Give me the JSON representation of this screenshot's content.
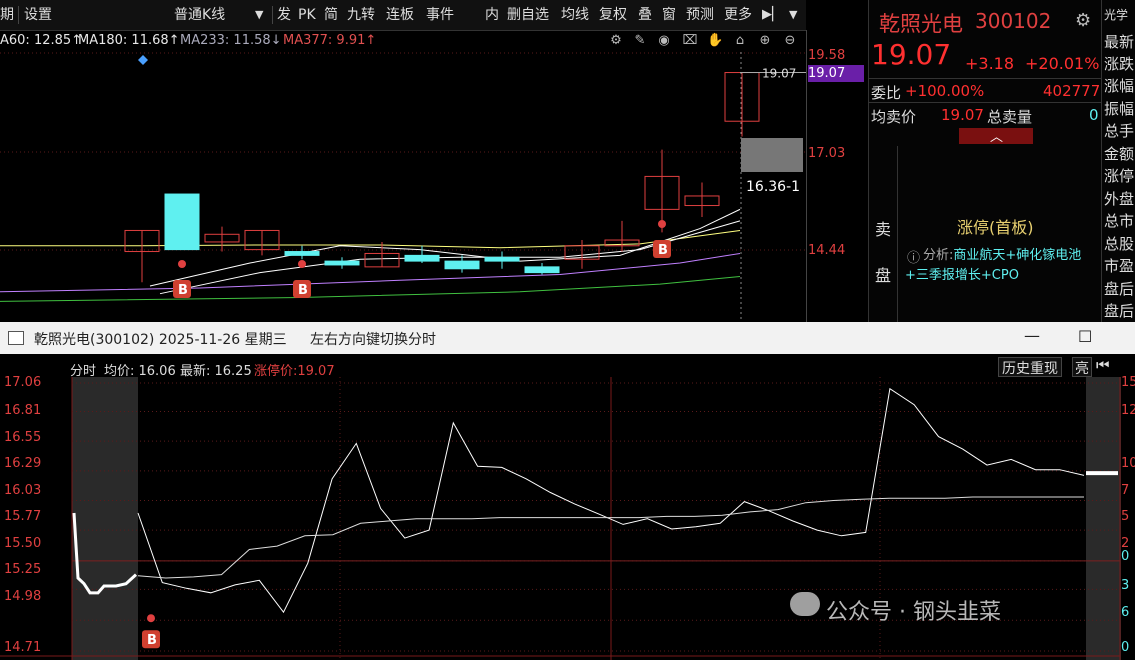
{
  "toolbar": {
    "items": [
      "期",
      "设置",
      "普通K线",
      "发",
      "PK",
      "简",
      "九转",
      "连板",
      "事件",
      "内",
      "删自选",
      "均线",
      "复权",
      "叠",
      "窗",
      "预测",
      "更多"
    ],
    "dropdown_arrow": "▼",
    "end_icon": "▶▏",
    "end_arrow": "▼"
  },
  "ma": {
    "ma60": "A60: 12.85↑",
    "ma180": "MA180: 11.68↑",
    "ma233": "MA233: 11.58↓",
    "ma377": "MA377: 9.91↑"
  },
  "kline_axis": [
    "19.58",
    "17.03",
    "14.44"
  ],
  "kline_labels": {
    "price_tag": "19.07",
    "price_tag_marker": "19.07",
    "cursor_value": "16.36-1",
    "buy_mark": "B"
  },
  "quote": {
    "name": "乾照光电",
    "code": "300102",
    "price": "19.07",
    "change": "+3.18",
    "change_pct": "+20.01%",
    "weibi_label": "委比",
    "weibi_value": "+100.00%",
    "weibi_amount": "402777",
    "avg_label": "均卖价",
    "avg_value": "19.07",
    "total_sell_label": "总卖量",
    "total_sell_value": "0",
    "sell_label_1": "卖",
    "sell_label_2": "盘",
    "limit_up": "涨停(首板)",
    "analysis_icon": "ⓘ",
    "analysis_prefix": "分析:",
    "analysis_text": "商业航天+砷化镓电池+三季报增长+CPO"
  },
  "right_strip": [
    "光学",
    "最新",
    "涨跌",
    "涨幅",
    "振幅",
    "总手",
    "金额",
    "涨停",
    "外盘",
    "总市",
    "总股",
    "市盈",
    "盘后",
    "盘后"
  ],
  "window": {
    "title": "乾照光电(300102) 2025-11-26 星期三",
    "hint": "左右方向键切换分时",
    "minimize": "—",
    "maximize": "☐"
  },
  "intraday": {
    "label": "分时",
    "avg_label": "均价: 16.06",
    "latest_label": "最新: 16.25",
    "limit_label": "涨停价:19.07",
    "history_button": "历史重现",
    "bright_button": "亮",
    "back_icon": "⏮"
  },
  "intraday_axis_left": [
    "17.06",
    "16.81",
    "16.55",
    "16.29",
    "16.03",
    "15.77",
    "15.50",
    "15.25",
    "14.98",
    "14.71"
  ],
  "intraday_axis_right": [
    "15",
    "12",
    "10",
    "7",
    "5",
    "2",
    "0",
    "3",
    "6",
    "0"
  ],
  "watermark": "公众号 · 钢头韭菜",
  "colors": {
    "up": "#e04040",
    "down": "#5ff0f0",
    "ma_yellow": "#ffff80",
    "ma_white": "#ffffff",
    "ma_violet": "#c080ff",
    "ma_green": "#40c040"
  },
  "chart_data": [
    {
      "type": "candlestick",
      "title": "",
      "y_axis_labels": [
        19.58,
        17.03,
        14.44
      ],
      "candles": [
        {
          "o": 14.4,
          "h": 14.95,
          "l": 13.6,
          "c": 14.95,
          "dir": "up"
        },
        {
          "o": 14.45,
          "h": 15.9,
          "l": 14.45,
          "c": 15.9,
          "dir": "down"
        },
        {
          "o": 14.65,
          "h": 15.05,
          "l": 14.4,
          "c": 14.85,
          "dir": "up"
        },
        {
          "o": 14.45,
          "h": 14.95,
          "l": 14.3,
          "c": 14.95,
          "dir": "up"
        },
        {
          "o": 14.4,
          "h": 14.55,
          "l": 14.2,
          "c": 14.3,
          "dir": "down"
        },
        {
          "o": 14.15,
          "h": 14.25,
          "l": 13.95,
          "c": 14.05,
          "dir": "down"
        },
        {
          "o": 14.35,
          "h": 14.65,
          "l": 14.0,
          "c": 14.0,
          "dir": "up"
        },
        {
          "o": 14.3,
          "h": 14.55,
          "l": 14.1,
          "c": 14.15,
          "dir": "down"
        },
        {
          "o": 14.15,
          "h": 14.3,
          "l": 13.85,
          "c": 13.95,
          "dir": "down"
        },
        {
          "o": 14.25,
          "h": 14.4,
          "l": 13.95,
          "c": 14.15,
          "dir": "down"
        },
        {
          "o": 14.0,
          "h": 14.1,
          "l": 13.8,
          "c": 13.85,
          "dir": "down"
        },
        {
          "o": 14.2,
          "h": 14.7,
          "l": 13.95,
          "c": 14.55,
          "dir": "up"
        },
        {
          "o": 14.7,
          "h": 15.2,
          "l": 14.4,
          "c": 14.55,
          "dir": "up"
        },
        {
          "o": 16.36,
          "h": 17.06,
          "l": 14.9,
          "c": 15.5,
          "dir": "up"
        },
        {
          "o": 15.6,
          "h": 16.2,
          "l": 15.3,
          "c": 15.85,
          "dir": "up"
        },
        {
          "o": 19.07,
          "h": 19.07,
          "l": 17.4,
          "c": 17.8,
          "dir": "up"
        }
      ]
    },
    {
      "type": "line",
      "title": "",
      "series": [
        {
          "name": "均价",
          "values": [
            15.37,
            15.35,
            15.36,
            15.38,
            15.6,
            15.63,
            15.72,
            15.73,
            15.83,
            15.85,
            15.87,
            15.87,
            15.87,
            15.88,
            15.88,
            15.88,
            15.88,
            15.88,
            15.88,
            15.89,
            15.89,
            15.9,
            15.93,
            15.95,
            16.01,
            16.03,
            16.04,
            16.05,
            16.05,
            16.05,
            16.06,
            16.06,
            16.06,
            16.06,
            16.06
          ]
        }
      ],
      "price_series": [
        15.92,
        15.31,
        15.26,
        15.22,
        15.29,
        15.33,
        15.05,
        15.48,
        16.22,
        16.53,
        15.96,
        15.7,
        15.77,
        16.71,
        16.33,
        16.32,
        16.22,
        16.1,
        16.0,
        15.91,
        15.82,
        15.87,
        15.78,
        15.8,
        15.83,
        16.02,
        15.94,
        15.85,
        15.77,
        15.72,
        15.75,
        17.01,
        16.87,
        16.59,
        16.48,
        16.34,
        16.39,
        16.3,
        16.3,
        16.25
      ],
      "y_axis_labels": [
        17.06,
        16.81,
        16.55,
        16.29,
        16.03,
        15.77,
        15.5,
        15.25,
        14.98,
        14.71
      ],
      "ylim": [
        14.71,
        17.06
      ]
    }
  ]
}
